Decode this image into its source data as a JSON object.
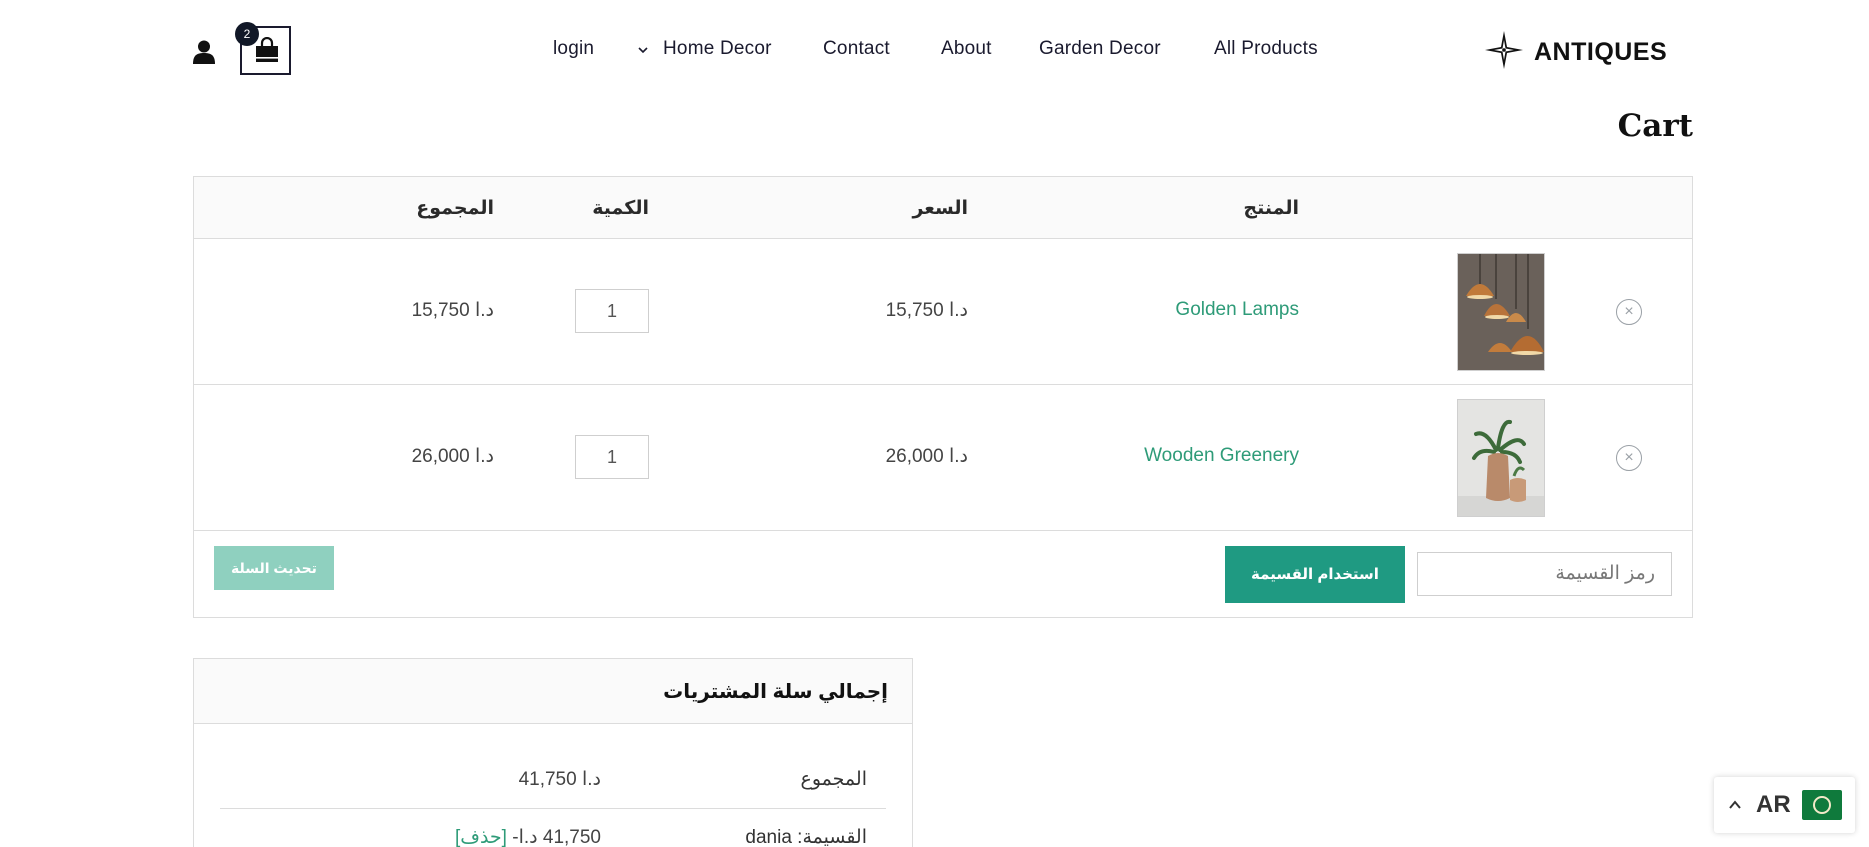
{
  "header": {
    "cart_count": "2",
    "nav": {
      "login": "login",
      "home_decor": "Home Decor",
      "contact": "Contact",
      "about": "About",
      "garden_decor": "Garden Decor",
      "all_products": "All Products"
    },
    "logo_text": "ANTIQUES"
  },
  "page": {
    "title": "Cart"
  },
  "cart": {
    "columns": {
      "product": "المنتج",
      "price": "السعر",
      "quantity": "الكمية",
      "subtotal": "المجموع"
    },
    "items": [
      {
        "name": "Golden Lamps",
        "price": "15,750 د.ا",
        "quantity": "1",
        "subtotal": "15,750 د.ا",
        "remove": "×"
      },
      {
        "name": "Wooden Greenery",
        "price": "26,000 د.ا",
        "quantity": "1",
        "subtotal": "26,000 د.ا",
        "remove": "×"
      }
    ],
    "coupon": {
      "placeholder": "رمز القسيمة",
      "apply_label": "استخدام القسيمة"
    },
    "update_label": "تحديث السلة"
  },
  "totals": {
    "title": "إجمالي سلة المشتريات",
    "subtotal_label": "المجموع",
    "subtotal_value": "41,750 د.ا",
    "coupon_label": "القسيمة: dania",
    "coupon_value": "-41,750 د.ا",
    "coupon_remove": "[حذف]"
  },
  "language": {
    "code": "AR"
  },
  "colors": {
    "accent": "#1f9a82",
    "link": "#2e9b78",
    "dark": "#111827"
  }
}
